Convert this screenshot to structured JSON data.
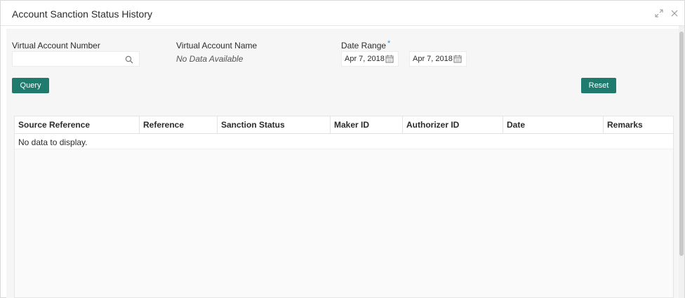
{
  "window": {
    "title": "Account Sanction Status History",
    "icons": [
      "expand-icon",
      "close-icon"
    ]
  },
  "filters": {
    "virtual_account_number": {
      "label": "Virtual Account Number",
      "value": "",
      "placeholder": ""
    },
    "virtual_account_name": {
      "label": "Virtual Account Name",
      "value": "No Data Available"
    },
    "date_range": {
      "label": "Date Range",
      "required_mark": "*",
      "from": "Apr 7, 2018",
      "to": "Apr 7, 2018"
    },
    "query_button": "Query",
    "reset_button": "Reset"
  },
  "table": {
    "columns": [
      "Source Reference",
      "Reference",
      "Sanction Status",
      "Maker ID",
      "Authorizer ID",
      "Date",
      "Remarks"
    ],
    "empty_message": "No data to display."
  },
  "colors": {
    "accent": "#1e7b6e",
    "required": "#2c8fd8",
    "panel_bg": "#f6f6f6"
  }
}
